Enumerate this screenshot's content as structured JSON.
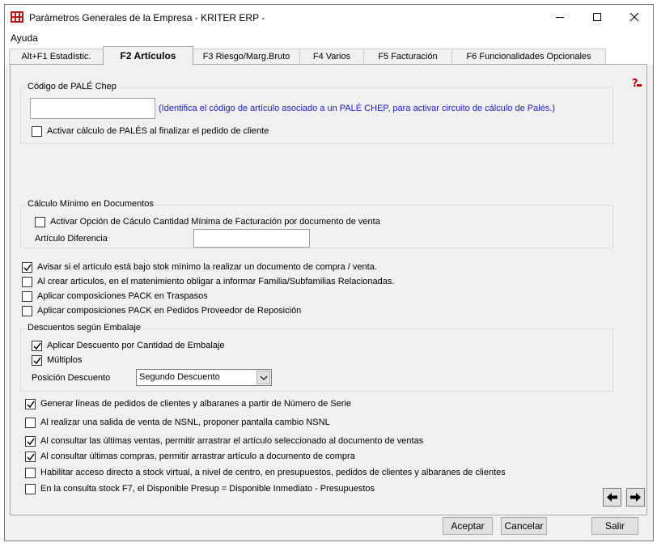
{
  "window": {
    "title": "Parámetros Generales de la Empresa - KRITER ERP -"
  },
  "menu": {
    "items": [
      {
        "label": "Ayuda"
      }
    ]
  },
  "tabs": [
    {
      "label": "Alt+F1 Estadístic.",
      "active": false
    },
    {
      "label": "F2 Artículos",
      "active": true
    },
    {
      "label": "F3 Riesgo/Marg.Bruto",
      "active": false
    },
    {
      "label": "F4 Varios",
      "active": false
    },
    {
      "label": "F5 Facturación",
      "active": false
    },
    {
      "label": "F6 Funcionalidades Opcionales",
      "active": false
    }
  ],
  "pale_group": {
    "legend": "Código de PALÉ Chep",
    "code_value": "",
    "info": "(Identifica el código de artículo asociado a un PALÉ CHEP, para activar circuito de cálculo de Palés.)",
    "activate": {
      "label": "Activar cálculo de PALÉS al finalizar el pedido de cliente",
      "checked": false
    }
  },
  "minimo_group": {
    "legend": "Cálculo Mínimo en Documentos",
    "activate": {
      "label": "Activar Opción de Cáculo Cantidad Mínima de Facturación por documento de venta",
      "checked": false
    },
    "articulo_label": "Artículo Diferencia",
    "articulo_value": ""
  },
  "options_a": [
    {
      "label": "Avisar si el artículo está bajo stok mínimo la realizar un documento de compra / venta.",
      "checked": true
    },
    {
      "label": "Al crear artículos, en el matenimiento obligar a informar Familia/Subfamilias Relacionadas.",
      "checked": false
    },
    {
      "label": "Aplicar composiciones PACK en Traspasos",
      "checked": false
    },
    {
      "label": "Aplicar composiciones PACK en Pedidos Proveedor de Reposición",
      "checked": false
    }
  ],
  "embalaje_group": {
    "legend": "Descuentos según Embalaje",
    "apply": {
      "label": "Aplicar Descuento por Cantidad de Embalaje",
      "checked": true
    },
    "multiplos": {
      "label": "Múltiplos",
      "checked": true
    },
    "position_label": "Posición Descuento",
    "position_value": "Segundo Descuento"
  },
  "options_b": [
    {
      "label": "Generar líneas de pedidos de clientes y albaranes a partir de Número de Serie",
      "checked": true
    },
    {
      "label": "Al realizar una salida de venta de NSNL, proponer pantalla cambio  NSNL",
      "checked": false
    },
    {
      "label": "Al consultar las últimas ventas, permitir arrastrar el artículo seleccionado al documento de ventas",
      "checked": true
    },
    {
      "label": "Al consultar últimas compras, permitir arrastrar artículo a documento de compra",
      "checked": true
    },
    {
      "label": "Habilitar acceso directo a stock virtual, a nivel de centro, en presupuestos, pedidos de clientes y albaranes de clientes",
      "checked": false
    },
    {
      "label": "En la consulta stock F7, el Disponible Presup = Disponible Inmediato - Presupuestos",
      "checked": false
    }
  ],
  "buttons": {
    "accept": "Aceptar",
    "cancel": "Cancelar",
    "exit": "Salir"
  },
  "icons": {
    "app": "kriter-app-icon",
    "help": "help-icon",
    "prev": "arrow-left-icon",
    "next": "arrow-right-icon"
  }
}
